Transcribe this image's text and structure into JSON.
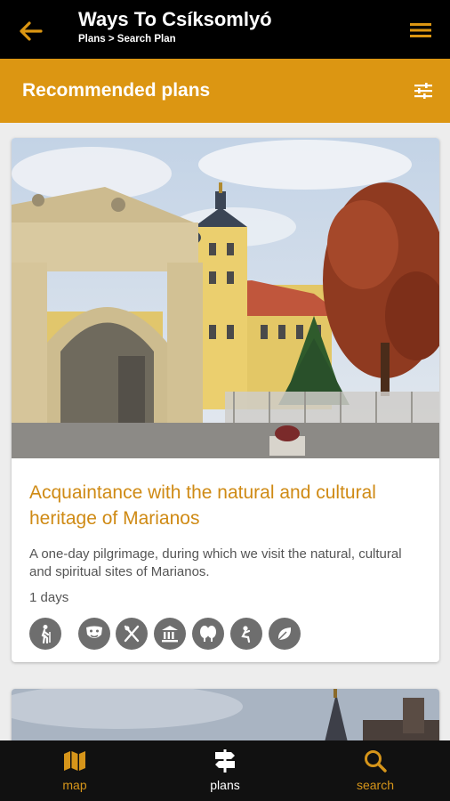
{
  "appbar": {
    "title": "Ways To Csíksomlyó",
    "breadcrumb": "Plans > Search Plan"
  },
  "section": {
    "heading": "Recommended plans"
  },
  "plans": [
    {
      "title": "Acquaintance with the natural and cultural heritage of Marianos",
      "description": "A one-day pilgrimage, during which we visit the natural, cultural and spiritual sites of Marianos.",
      "duration": "1 days",
      "tags": [
        "hiking-icon",
        "theatre-masks-icon",
        "restaurant-icon",
        "museum-icon",
        "forest-icon",
        "prayer-icon",
        "leaf-icon"
      ]
    }
  ],
  "bottom_nav": {
    "map_label": "map",
    "plans_label": "plans",
    "search_label": "search",
    "active": "plans"
  },
  "colors": {
    "accent": "#dc9612",
    "title_accent": "#cf8a14",
    "bar": "#000000",
    "tag_bg": "#6e6e6e"
  }
}
